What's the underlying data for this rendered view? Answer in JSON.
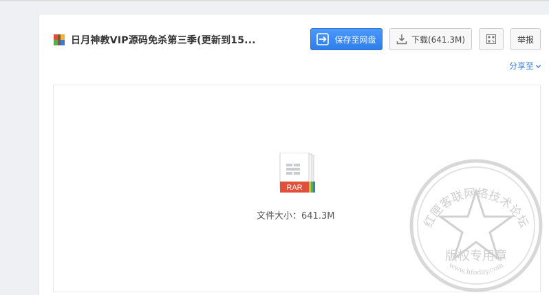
{
  "file": {
    "title": "日月神教VIP源码免杀第三季(更新到15...",
    "icon": "rar-archive-icon"
  },
  "toolbar": {
    "save_label": "保存至网盘",
    "download_label": "下载(641.3M)",
    "report_label": "举报",
    "qr_icon": "qrcode-icon"
  },
  "share": {
    "label": "分享至"
  },
  "preview": {
    "file_type_badge": "RAR",
    "size_prefix": "文件大小：",
    "size_value": "641.3M"
  },
  "watermark": {
    "top_text": "红匣客联网络技术论坛",
    "bottom_text": "版权专用章",
    "url": "www.hfoday.com"
  },
  "colors": {
    "accent": "#3b8cff",
    "link": "#3b7fd8",
    "rar_red": "#e0503a"
  }
}
